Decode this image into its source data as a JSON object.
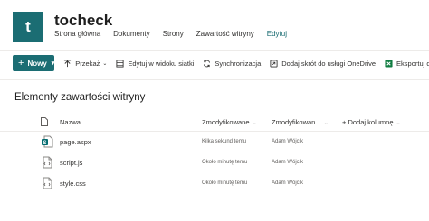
{
  "site": {
    "logo_letter": "t",
    "title": "tocheck",
    "nav": [
      "Strona główna",
      "Dokumenty",
      "Strony",
      "Zawartość witryny"
    ],
    "edit_link": "Edytuj"
  },
  "command_bar": {
    "new_label": "Nowy",
    "transfer_label": "Przekaż",
    "grid_edit_label": "Edytuj w widoku siatki",
    "sync_label": "Synchronizacja",
    "shortcut_label": "Dodaj skrót do usługi OneDrive",
    "export_label": "Eksportuj do"
  },
  "page": {
    "title": "Elementy zawartości witryny"
  },
  "table": {
    "columns": {
      "name": "Nazwa",
      "modified": "Zmodyfikowane",
      "modified_by": "Zmodyfikowan...",
      "add_column": "+ Dodaj kolumnę"
    },
    "rows": [
      {
        "name": "page.aspx",
        "modified": "Kilka sekund temu",
        "modified_by": "Adam Wójcik",
        "icon": "aspx-file-icon"
      },
      {
        "name": "script.js",
        "modified": "Około minutę temu",
        "modified_by": "Adam Wójcik",
        "icon": "js-file-icon"
      },
      {
        "name": "style.css",
        "modified": "Około minutę temu",
        "modified_by": "Adam Wójcik",
        "icon": "css-file-icon"
      }
    ]
  },
  "colors": {
    "accent": "#1b6d73",
    "excel_green": "#107c41"
  }
}
